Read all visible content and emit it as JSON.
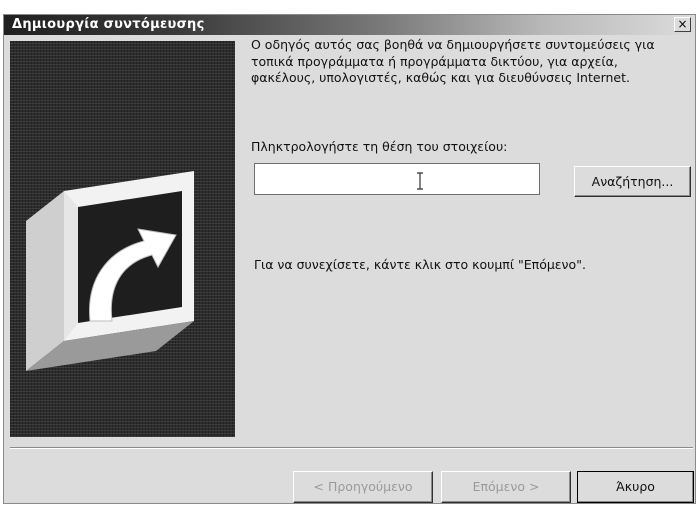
{
  "window": {
    "title": "Δημιουργία συντόμευσης",
    "close_glyph": "×"
  },
  "side_panel": {
    "icon": "shortcut-arrow-icon"
  },
  "main": {
    "intro_text": "Ο οδηγός αυτός σας βοηθά να δημιουργήσετε συντομεύσεις για τοπικά προγράμματα ή προγράμματα δικτύου, για αρχεία, φακέλους, υπολογιστές, καθώς και για διευθύνσεις Internet.",
    "location_label": "Πληκτρολογήστε τη θέση του στοιχείου:",
    "location_value": "",
    "browse_label": "Αναζήτηση...",
    "continue_text": "Για να συνεχίσετε, κάντε κλικ στο κουμπί \"Επόμενο\"."
  },
  "footer": {
    "back_label": "< Προηγούμενο",
    "next_label": "Επόμενο >",
    "cancel_label": "Άκυρο"
  }
}
